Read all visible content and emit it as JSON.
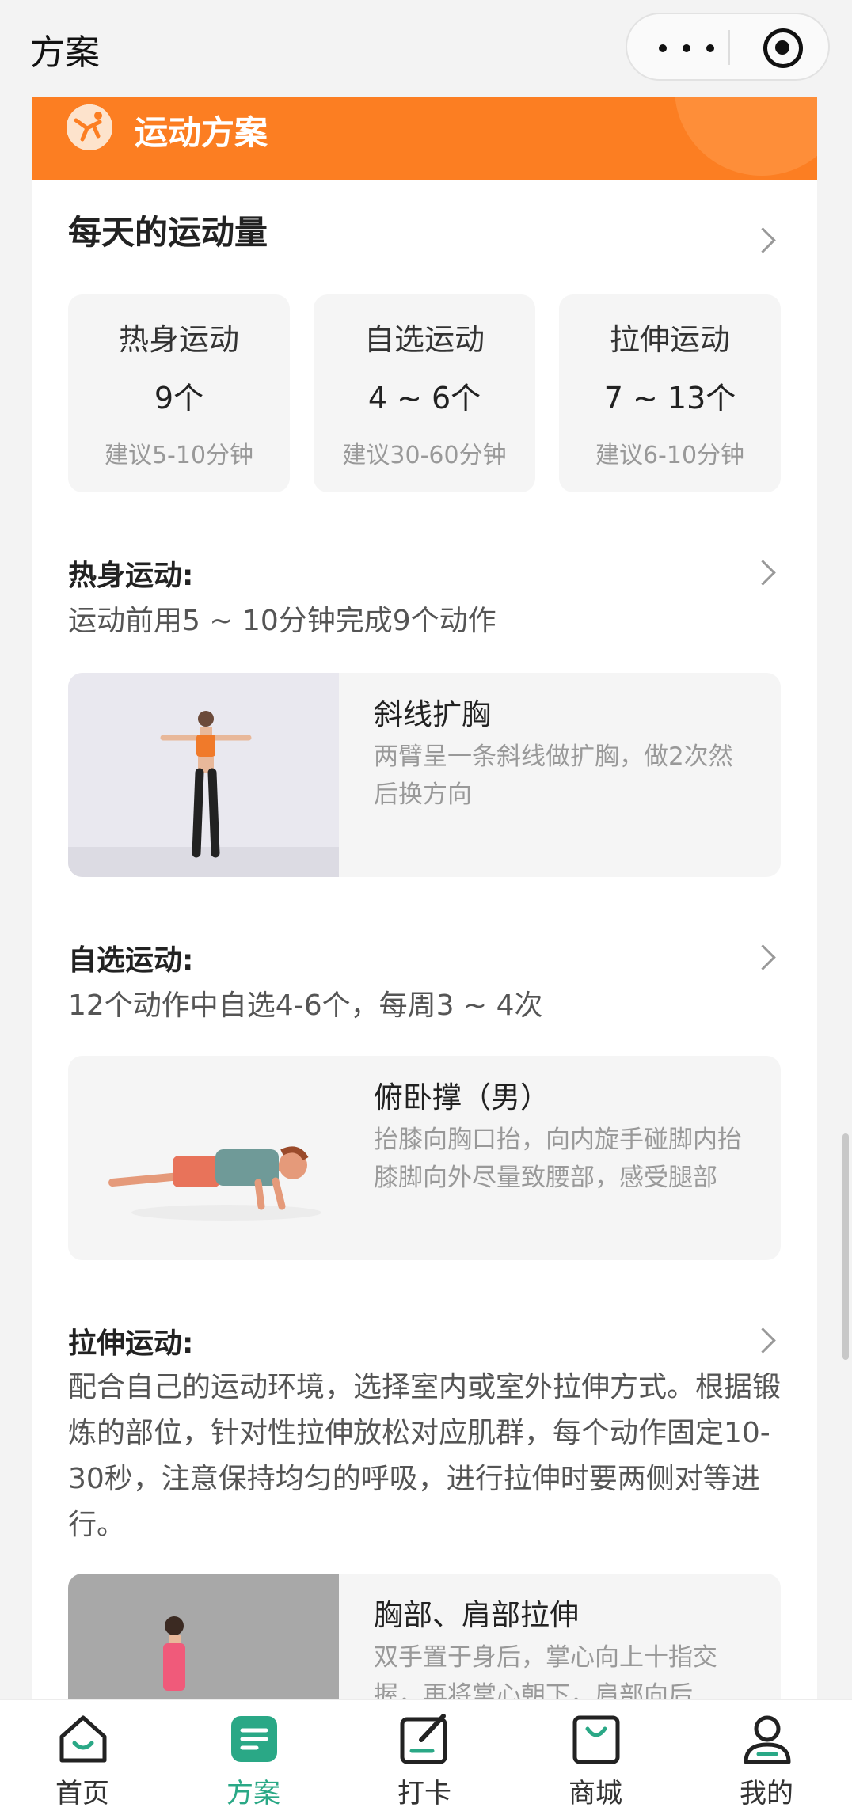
{
  "topbar": {
    "title": "方案"
  },
  "banner": {
    "title": "运动方案"
  },
  "daily": {
    "title": "每天的运动量",
    "stats": [
      {
        "name": "热身运动",
        "count": "9个",
        "hint": "建议5-10分钟"
      },
      {
        "name": "自选运动",
        "count": "4 ~ 6个",
        "hint": "建议30-60分钟"
      },
      {
        "name": "拉伸运动",
        "count": "7 ~ 13个",
        "hint": "建议6-10分钟"
      }
    ]
  },
  "warmup": {
    "title": "热身运动:",
    "desc": "运动前用5 ~ 10分钟完成9个动作",
    "exercise": {
      "name": "斜线扩胸",
      "desc": "两臂呈一条斜线做扩胸，做2次然后换方向"
    }
  },
  "optional": {
    "title": "自选运动:",
    "desc": "12个动作中自选4-6个，每周3 ~ 4次",
    "exercise": {
      "name": "俯卧撑（男）",
      "desc": "抬膝向胸口抬，向内旋手碰脚内抬膝脚向外尽量致腰部，感受腿部"
    }
  },
  "stretch": {
    "title": "拉伸运动:",
    "desc": "配合自己的运动环境，选择室内或室外拉伸方式。根据锻炼的部位，针对性拉伸放松对应肌群，每个动作固定10-30秒，注意保持均匀的呼吸，进行拉伸时要两侧对等进行。",
    "exercise": {
      "name": "胸部、肩部拉伸",
      "desc": "双手置于身后，掌心向上十指交握，再将掌心朝下，肩部向后"
    }
  },
  "tabs": [
    {
      "label": "首页",
      "icon": "home-icon"
    },
    {
      "label": "方案",
      "icon": "plan-icon",
      "active": true
    },
    {
      "label": "打卡",
      "icon": "checkin-icon"
    },
    {
      "label": "商城",
      "icon": "shop-icon"
    },
    {
      "label": "我的",
      "icon": "profile-icon"
    }
  ],
  "colors": {
    "accent": "#fc7e22",
    "tab_active": "#2aa886"
  }
}
